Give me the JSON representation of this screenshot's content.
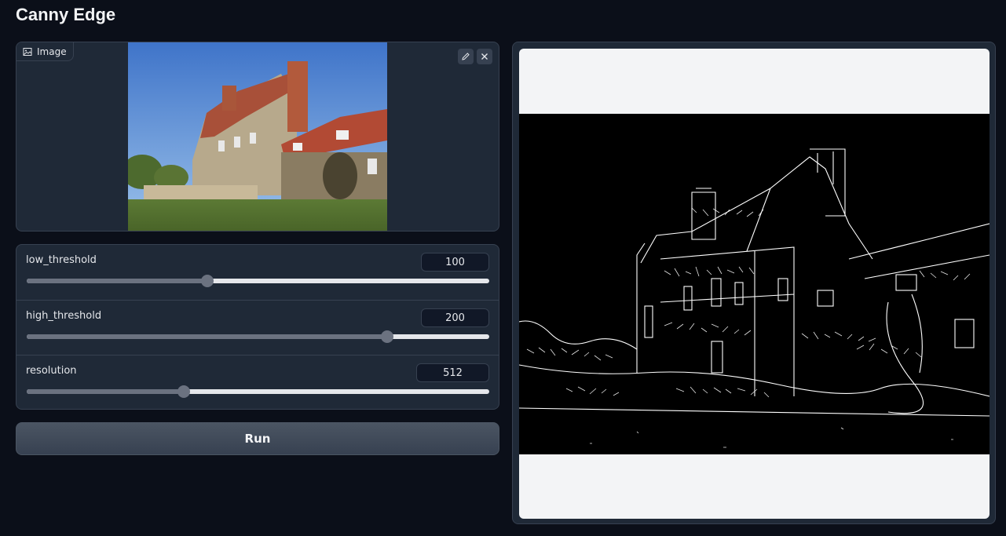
{
  "app": {
    "title": "Canny Edge"
  },
  "input_image": {
    "label": "Image"
  },
  "sliders": [
    {
      "label": "low_threshold",
      "value": "100",
      "fraction": 0.39
    },
    {
      "label": "high_threshold",
      "value": "200",
      "fraction": 0.78
    },
    {
      "label": "resolution",
      "value": "512",
      "fraction": 0.34
    }
  ],
  "run_button": {
    "label": "Run"
  },
  "icons": {
    "image": "image-icon",
    "edit": "pencil-icon",
    "close": "close-icon"
  }
}
